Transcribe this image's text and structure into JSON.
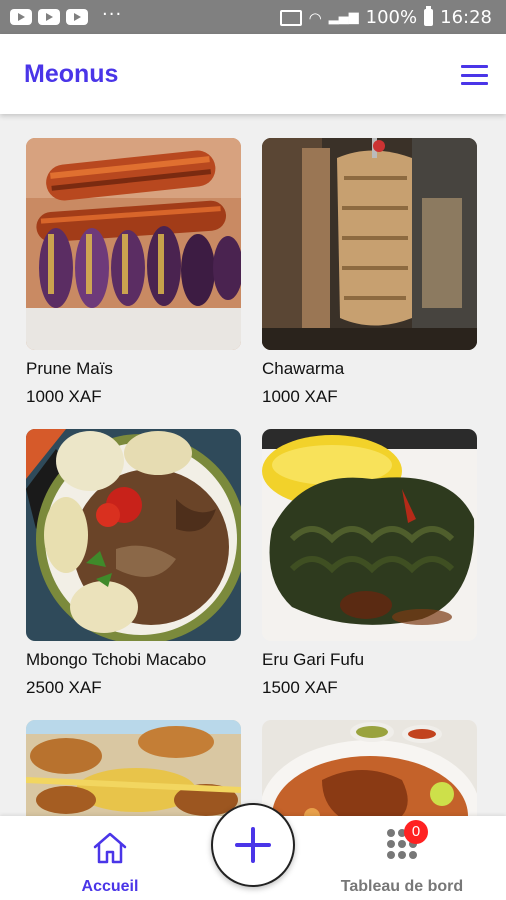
{
  "status_bar": {
    "battery": "100%",
    "time": "16:28"
  },
  "app_bar": {
    "title": "Meonus",
    "menu_icon": "hamburger-menu-icon"
  },
  "dishes": [
    {
      "name": "Prune Maïs",
      "price": "1000 XAF"
    },
    {
      "name": "Chawarma",
      "price": "1000 XAF"
    },
    {
      "name": "Mbongo Tchobi Macabo",
      "price": "2500 XAF"
    },
    {
      "name": "Eru Gari Fufu",
      "price": "1500 XAF"
    },
    {
      "name": "",
      "price": ""
    },
    {
      "name": "",
      "price": ""
    }
  ],
  "bottom_nav": {
    "home_label": "Accueil",
    "dashboard_label": "Tableau de bord",
    "dashboard_badge": "0",
    "add_icon": "plus-icon"
  },
  "colors": {
    "accent": "#4a35e8",
    "badge": "#ff2222"
  }
}
